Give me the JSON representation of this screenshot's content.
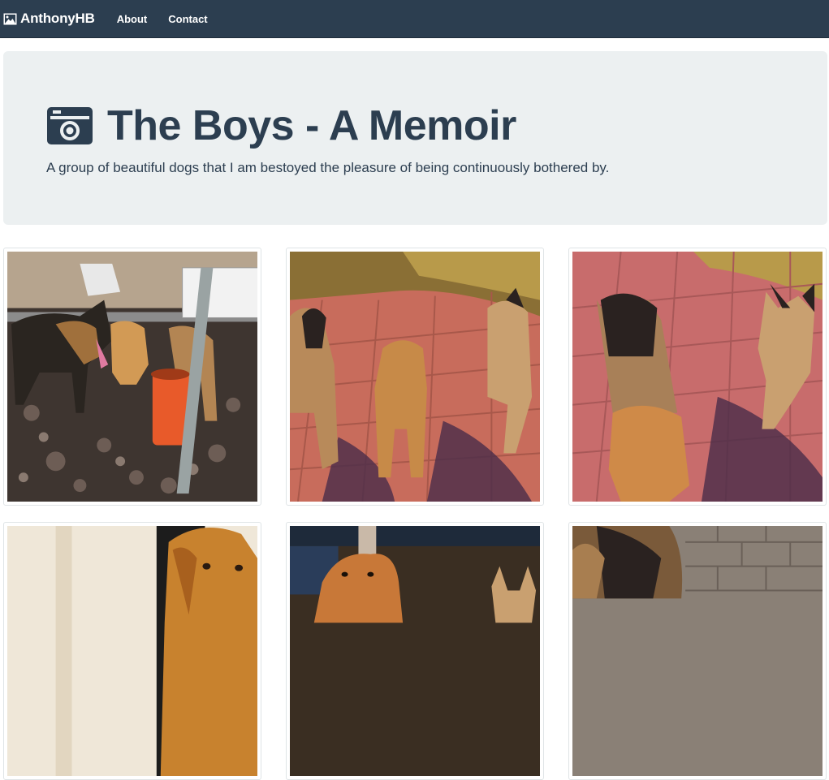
{
  "navbar": {
    "brand": "AnthonyHB",
    "brand_icon": "picture-icon",
    "links": [
      "About",
      "Contact"
    ],
    "background": "#2c3e50"
  },
  "jumbotron": {
    "title": "The Boys - A Memoir",
    "title_icon": "camera-icon",
    "subtitle": "A group of beautiful dogs that I am bestoyed the pleasure of being continuously bothered by.",
    "background": "#ecf0f1",
    "text_color": "#2c3e50"
  },
  "gallery": {
    "photos": [
      "dogs-on-rocks-with-orange-bucket",
      "three-dogs-on-brick-patio",
      "dogs-on-brick-patio-closeup",
      "golden-retriever-indoors",
      "golden-retriever-and-shepherd-in-yard",
      "german-shepherd-closeup"
    ]
  }
}
